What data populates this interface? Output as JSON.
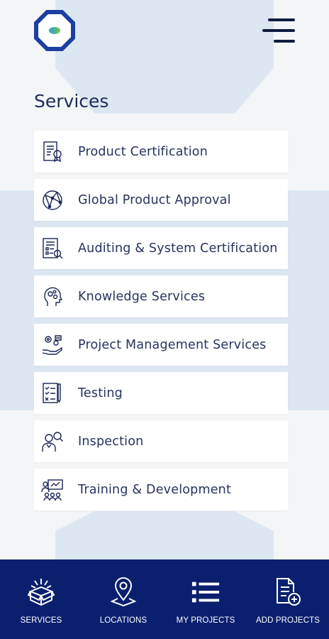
{
  "header": {
    "logo_icon": "company-logo",
    "menu_icon": "hamburger-menu-icon"
  },
  "page": {
    "title": "Services"
  },
  "services": [
    {
      "label": "Product Certification",
      "icon": "certificate-document-icon"
    },
    {
      "label": "Global Product Approval",
      "icon": "globe-network-icon"
    },
    {
      "label": "Auditing & System Certification",
      "icon": "audit-report-icon"
    },
    {
      "label": "Knowledge Services",
      "icon": "head-gears-icon"
    },
    {
      "label": "Project Management Services",
      "icon": "hand-gear-icon"
    },
    {
      "label": "Testing",
      "icon": "checklist-pen-icon"
    },
    {
      "label": "Inspection",
      "icon": "person-magnifier-icon"
    },
    {
      "label": "Training & Development",
      "icon": "presentation-group-icon"
    }
  ],
  "bottom_nav": {
    "services": "SERVICES",
    "locations": "LOCATIONS",
    "my_projects": "MY PROJECTS",
    "add_projects": "ADD PROJECTS"
  },
  "colors": {
    "nav_background": "#0a1f6e",
    "background_accent": "#dde7f1",
    "text_primary": "#1c2a5b"
  }
}
